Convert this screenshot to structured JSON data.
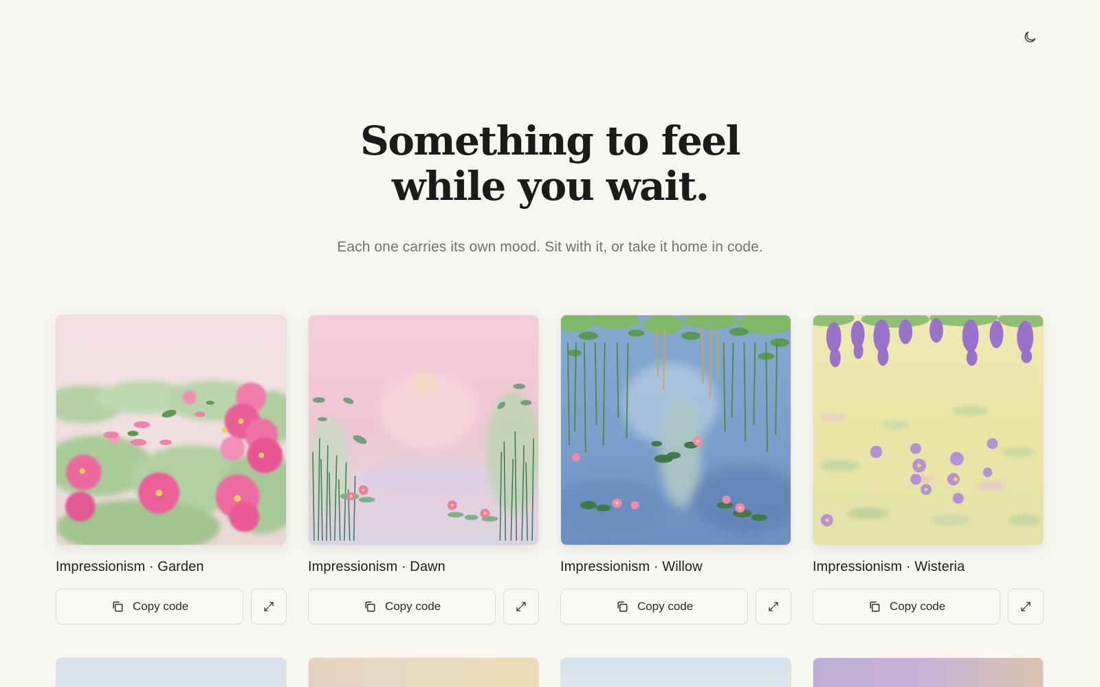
{
  "header": {
    "theme_toggle_icon": "moon-icon"
  },
  "hero": {
    "title_line1": "Something to feel",
    "title_line2": "while you wait.",
    "subtitle": "Each one carries its own mood. Sit with it, or take it home in code."
  },
  "cards": [
    {
      "title": "Impressionism · Garden",
      "copy_label": "Copy code",
      "art": "garden"
    },
    {
      "title": "Impressionism · Dawn",
      "copy_label": "Copy code",
      "art": "dawn"
    },
    {
      "title": "Impressionism · Willow",
      "copy_label": "Copy code",
      "art": "willow"
    },
    {
      "title": "Impressionism · Wisteria",
      "copy_label": "Copy code",
      "art": "wisteria"
    }
  ],
  "icons": {
    "copy": "copy-icon",
    "expand": "expand-icon"
  },
  "colors": {
    "background": "#f8f6f1",
    "text": "#1c1b19",
    "muted": "#75716b",
    "border": "#dedad2"
  }
}
